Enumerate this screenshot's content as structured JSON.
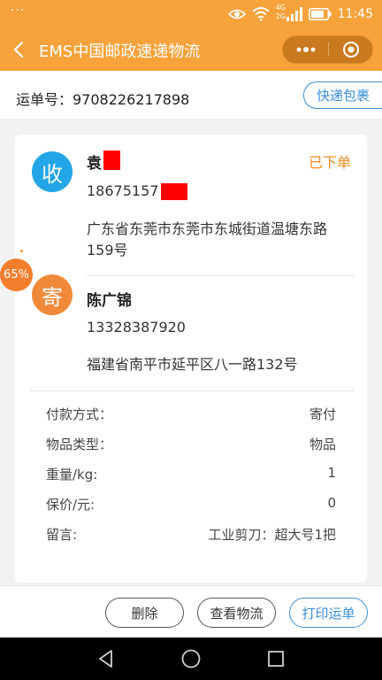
{
  "status_bar": {
    "dots": "···",
    "network_top": "4G",
    "network_bottom": "2G",
    "time": "11:45"
  },
  "nav": {
    "title": "EMS中国邮政速递物流",
    "icons": {
      "back": "chevron-left-icon",
      "more": "more-dots-icon",
      "close": "target-circle-icon"
    }
  },
  "waybill": {
    "label": "运单号：9708226217898",
    "express_button": "快递包裹"
  },
  "receiver": {
    "badge": "收",
    "name": "袁",
    "phone": "18675157",
    "address": "广东省东莞市东莞市东城街道温塘东路159号",
    "status": "已下单"
  },
  "sender": {
    "badge": "寄",
    "name": "陈广锦",
    "phone": "13328387920",
    "address": "福建省南平市延平区八一路132号"
  },
  "details": [
    {
      "key": "付款方式：",
      "value": "寄付"
    },
    {
      "key": "物品类型：",
      "value": "物品"
    },
    {
      "key": "重量/kg:",
      "value": "1"
    },
    {
      "key": "保价/元:",
      "value": "0"
    },
    {
      "key": "留言:",
      "value": "工业剪刀：超大号1把"
    }
  ],
  "floating_badge": "65%",
  "actions": {
    "delete": "删除",
    "track": "查看物流",
    "print": "打印运单"
  },
  "colors": {
    "header": "#f7a23b",
    "accent_blue": "#3b8fdc",
    "receiver_badge": "#22a6e8",
    "sender_badge": "#f08a3a",
    "status_orange": "#f08a1c",
    "redaction": "#ff0000"
  }
}
